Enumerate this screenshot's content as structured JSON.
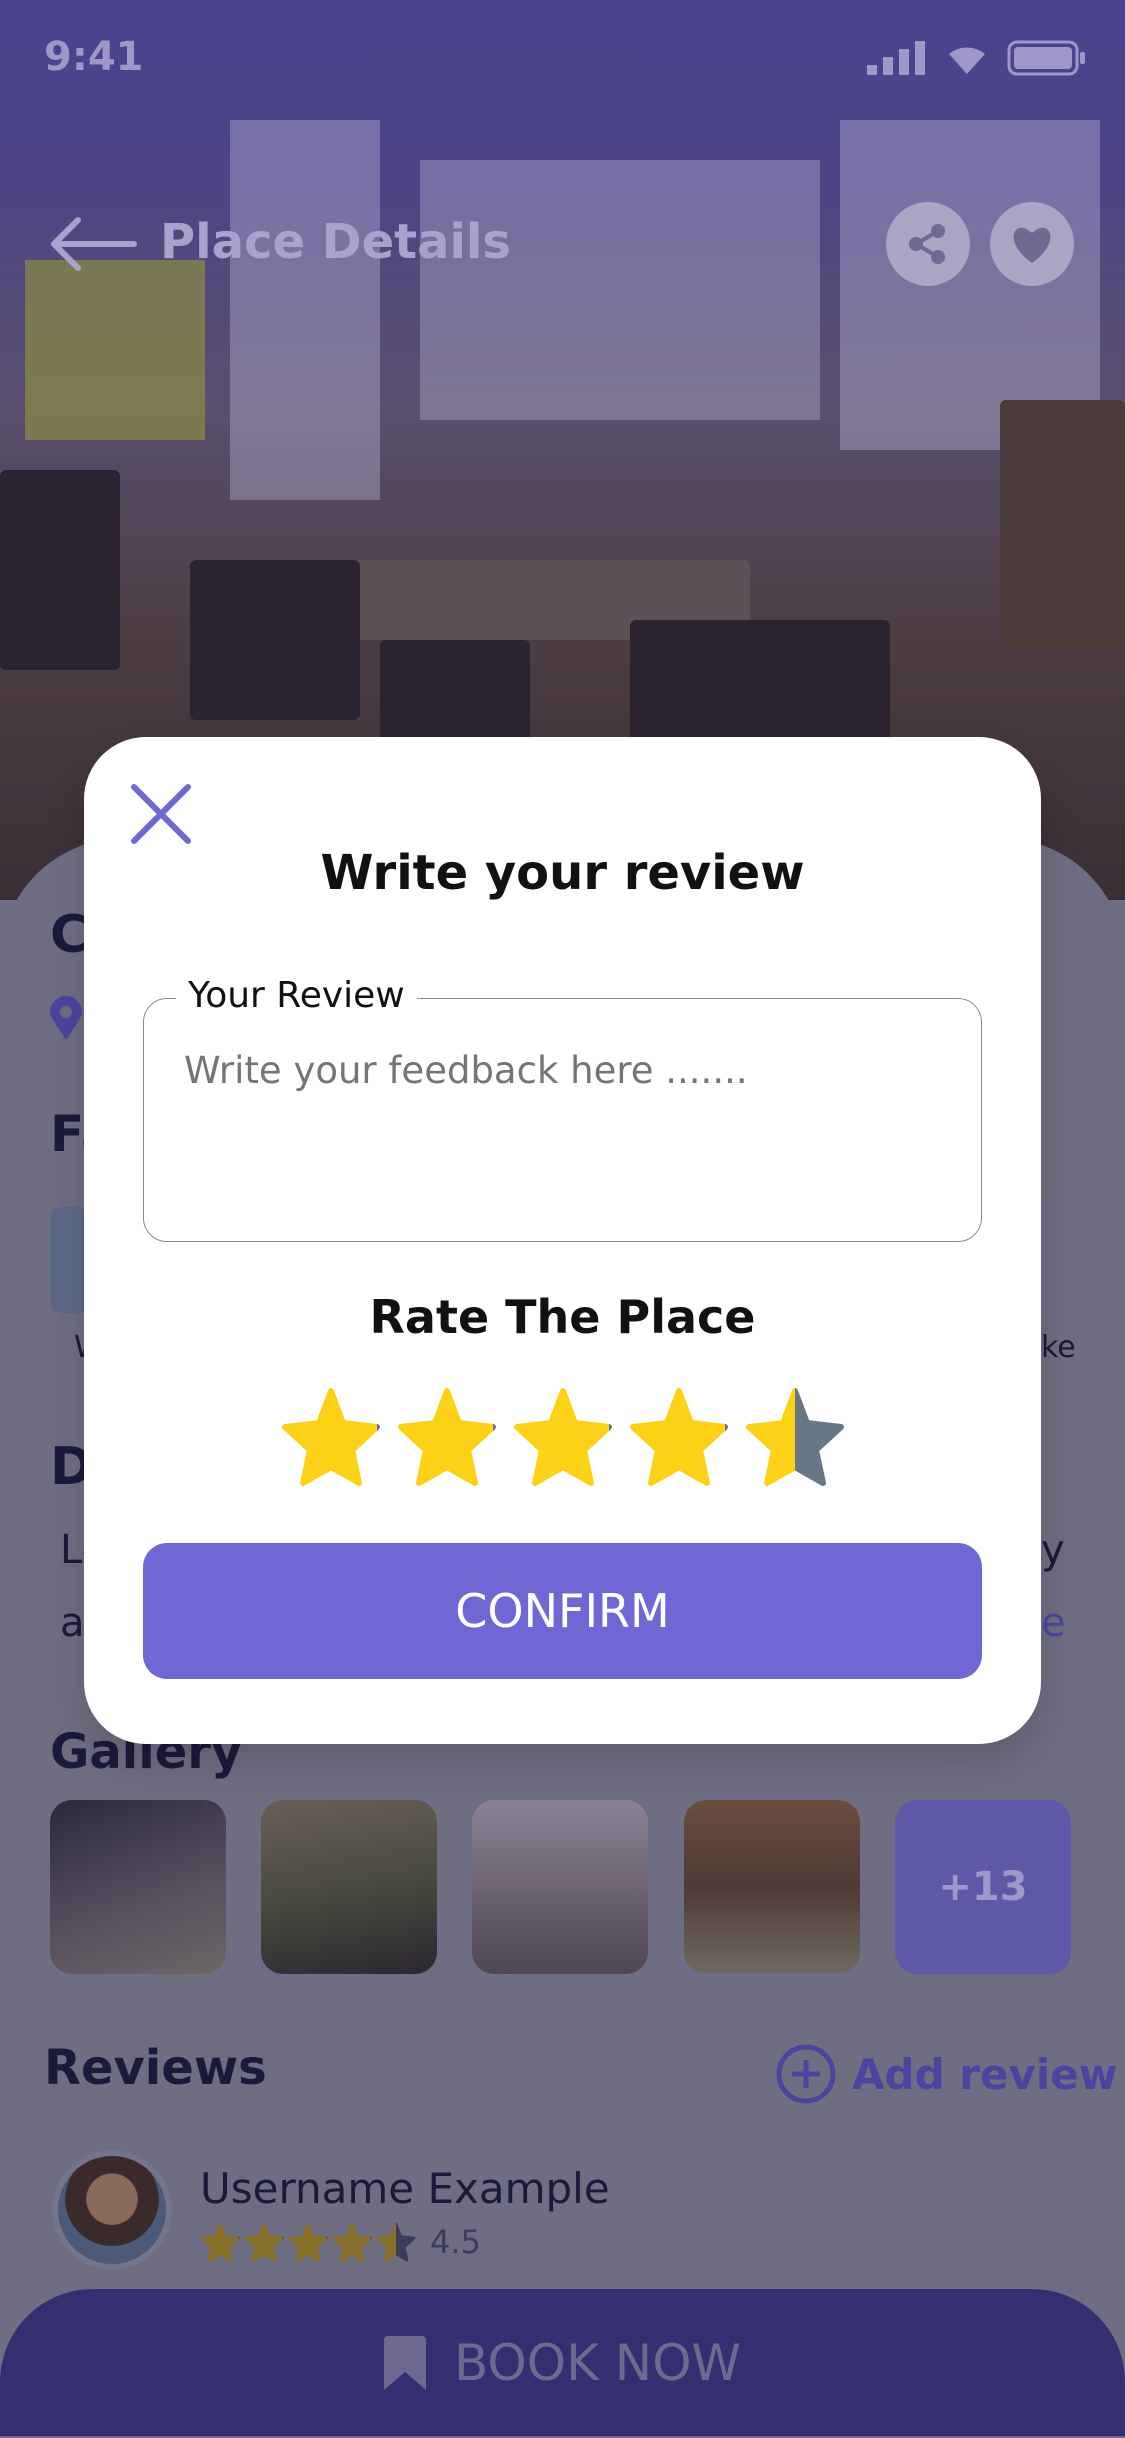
{
  "status_bar": {
    "time": "9:41"
  },
  "header": {
    "title": "Place Details"
  },
  "background": {
    "place_title_fragment": "C",
    "facilities_fragment": "Fa",
    "facility_label_left_fragment": "W",
    "facility_label_right_fragment": "ke",
    "description_fragment": "D",
    "description_line1_fragment": "Lo",
    "description_line1_right_fragment": "y",
    "description_line2_fragment": "a",
    "read_more_fragment": "e",
    "gallery_title": "Gallery",
    "gallery_more": "+13",
    "reviews_title": "Reviews",
    "add_review": "Add review",
    "review": {
      "username": "Username Example",
      "rating": 4.5,
      "rating_text": "4.5"
    },
    "book_now": "BOOK NOW"
  },
  "modal": {
    "title": "Write your review",
    "review_label": "Your Review",
    "review_value": "",
    "review_placeholder": "Write your feedback here .......",
    "rate_title": "Rate The Place",
    "rating": 4.5,
    "confirm": "CONFIRM"
  },
  "colors": {
    "accent": "#6f67d4",
    "star": "#fcd116",
    "star_empty": "#677788",
    "book_bar": "#352e70"
  }
}
